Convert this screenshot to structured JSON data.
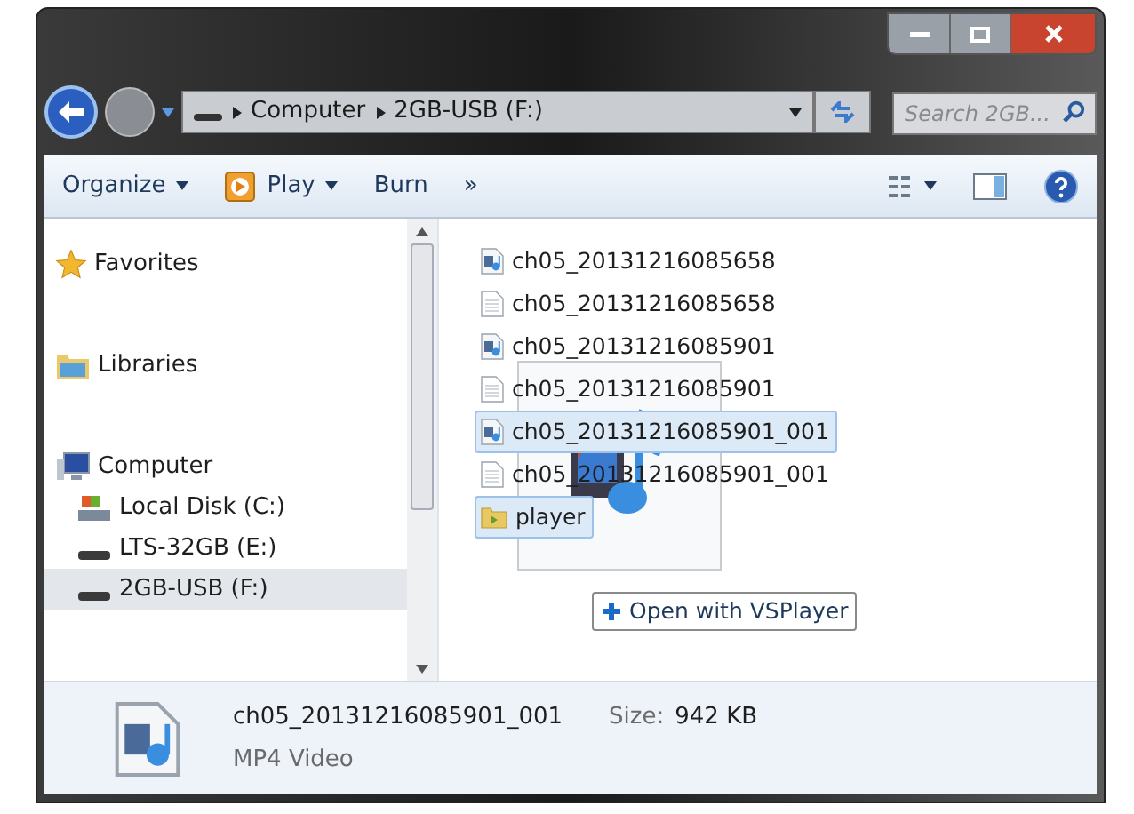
{
  "address_bar": {
    "breadcrumbs": [
      "Computer",
      "2GB-USB (F:)"
    ]
  },
  "search": {
    "placeholder": "Search 2GB..."
  },
  "toolbar": [
    {
      "label": "Organize",
      "kind": "menu"
    },
    {
      "label": "Play",
      "kind": "play"
    },
    {
      "label": "Burn",
      "kind": "plain"
    },
    {
      "label": "»",
      "kind": "plain"
    }
  ],
  "navigation": [
    {
      "label": "Favorites",
      "kind": "star",
      "selected": false
    },
    {
      "label": "Libraries",
      "kind": "library",
      "selected": false
    },
    {
      "label": "Computer",
      "kind": "computer",
      "selected": false,
      "children": [
        {
          "label": "Local Disk (C:)",
          "kind": "disk",
          "selected": false
        },
        {
          "label": "LTS-32GB (E:)",
          "kind": "drive",
          "selected": false
        },
        {
          "label": "2GB-USB (F:)",
          "kind": "drive",
          "selected": true
        }
      ]
    }
  ],
  "files": [
    {
      "name": "ch05_20131216085658",
      "kind": "video",
      "selected": false
    },
    {
      "name": "ch05_20131216085658",
      "kind": "text",
      "selected": false
    },
    {
      "name": "ch05_20131216085901",
      "kind": "video",
      "selected": false
    },
    {
      "name": "ch05_20131216085901",
      "kind": "text",
      "selected": false
    },
    {
      "name": "ch05_20131216085901_001",
      "kind": "video",
      "selected": true
    },
    {
      "name": "ch05_20131216085901_001",
      "kind": "text",
      "selected": false
    },
    {
      "name": "player",
      "kind": "folder",
      "selected": true
    }
  ],
  "drag": {
    "tooltip": "Open with VSPlayer"
  },
  "details": {
    "name": "ch05_20131216085901_001",
    "size_label": "Size:",
    "size": "942 KB",
    "type": "MP4 Video"
  }
}
